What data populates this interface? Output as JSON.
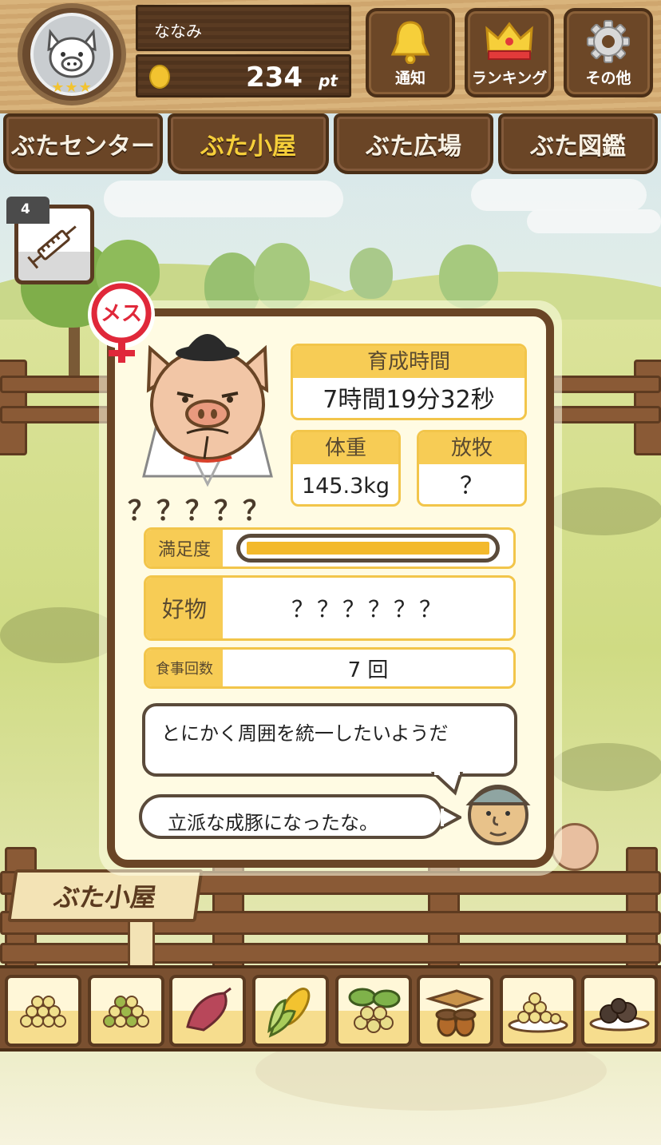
{
  "user": {
    "name": "ななみ",
    "points": "234",
    "points_unit": "pt",
    "rank_stars": 3
  },
  "header_buttons": [
    {
      "label": "通知",
      "icon": "bell-icon"
    },
    {
      "label": "ランキング",
      "icon": "crown-icon"
    },
    {
      "label": "その他",
      "icon": "gear-icon"
    }
  ],
  "tabs": [
    {
      "label": "ぶたセンター",
      "active": false
    },
    {
      "label": "ぶた小屋",
      "active": true
    },
    {
      "label": "ぶた広場",
      "active": false
    },
    {
      "label": "ぶた図鑑",
      "active": false
    }
  ],
  "item": {
    "count": "4",
    "icon": "syringe-icon"
  },
  "pig": {
    "gender_label": "メス",
    "name": "？？？？？",
    "stats": {
      "growth_time_label": "育成時間",
      "growth_time_value": "7時間19分32秒",
      "weight_label": "体重",
      "weight_value": "145.3kg",
      "grazing_label": "放牧",
      "grazing_value": "？",
      "satisfaction_label": "満足度",
      "satisfaction_fraction": 1.0,
      "favorite_label": "好物",
      "favorite_value": "？？？？？？",
      "meals_label": "食事回数",
      "meals_value": "7 回"
    },
    "comment": "とにかく周囲を統一したいようだ",
    "farmer_message": "立派な成豚になったな。"
  },
  "place_sign": "ぶた小屋",
  "food_items": [
    {
      "icon": "soybean-pile-icon"
    },
    {
      "icon": "mixed-bean-pile-icon"
    },
    {
      "icon": "sweet-potato-icon"
    },
    {
      "icon": "corn-icon"
    },
    {
      "icon": "leafy-beans-icon"
    },
    {
      "icon": "acorn-icon"
    },
    {
      "icon": "bean-plate-icon"
    },
    {
      "icon": "truffle-plate-icon"
    }
  ],
  "colors": {
    "wood_dark": "#6a4526",
    "accent_yellow": "#f7cc55",
    "active_tab_text": "#f6cf3a",
    "gender_red": "#e0283a"
  }
}
